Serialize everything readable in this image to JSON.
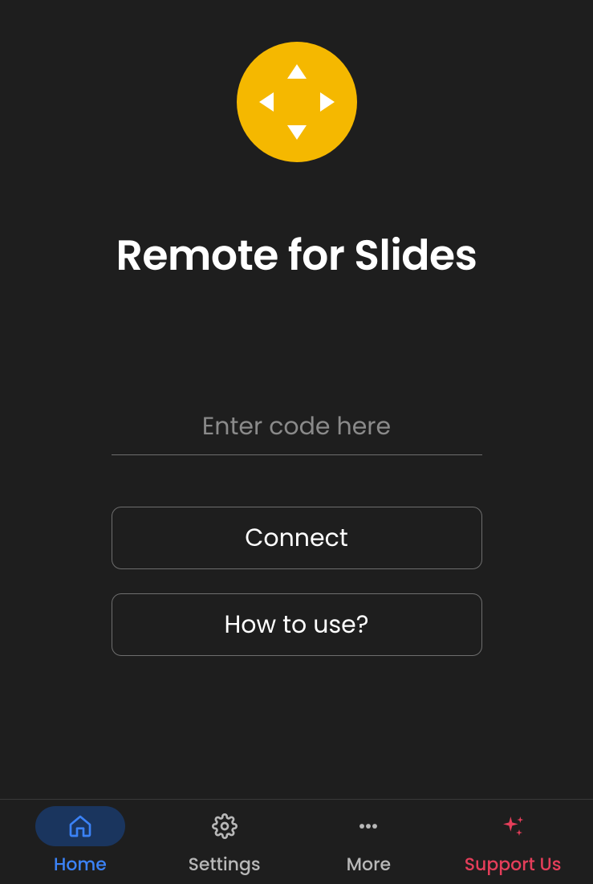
{
  "app": {
    "title": "Remote for Slides"
  },
  "input": {
    "placeholder": "Enter code here",
    "value": ""
  },
  "buttons": {
    "connect": "Connect",
    "howto": "How to use?"
  },
  "nav": {
    "home": "Home",
    "settings": "Settings",
    "more": "More",
    "support": "Support Us"
  },
  "colors": {
    "accent_yellow": "#f5b800",
    "accent_blue": "#3b82f6",
    "accent_red": "#e53e5a",
    "background": "#1e1e1e"
  }
}
